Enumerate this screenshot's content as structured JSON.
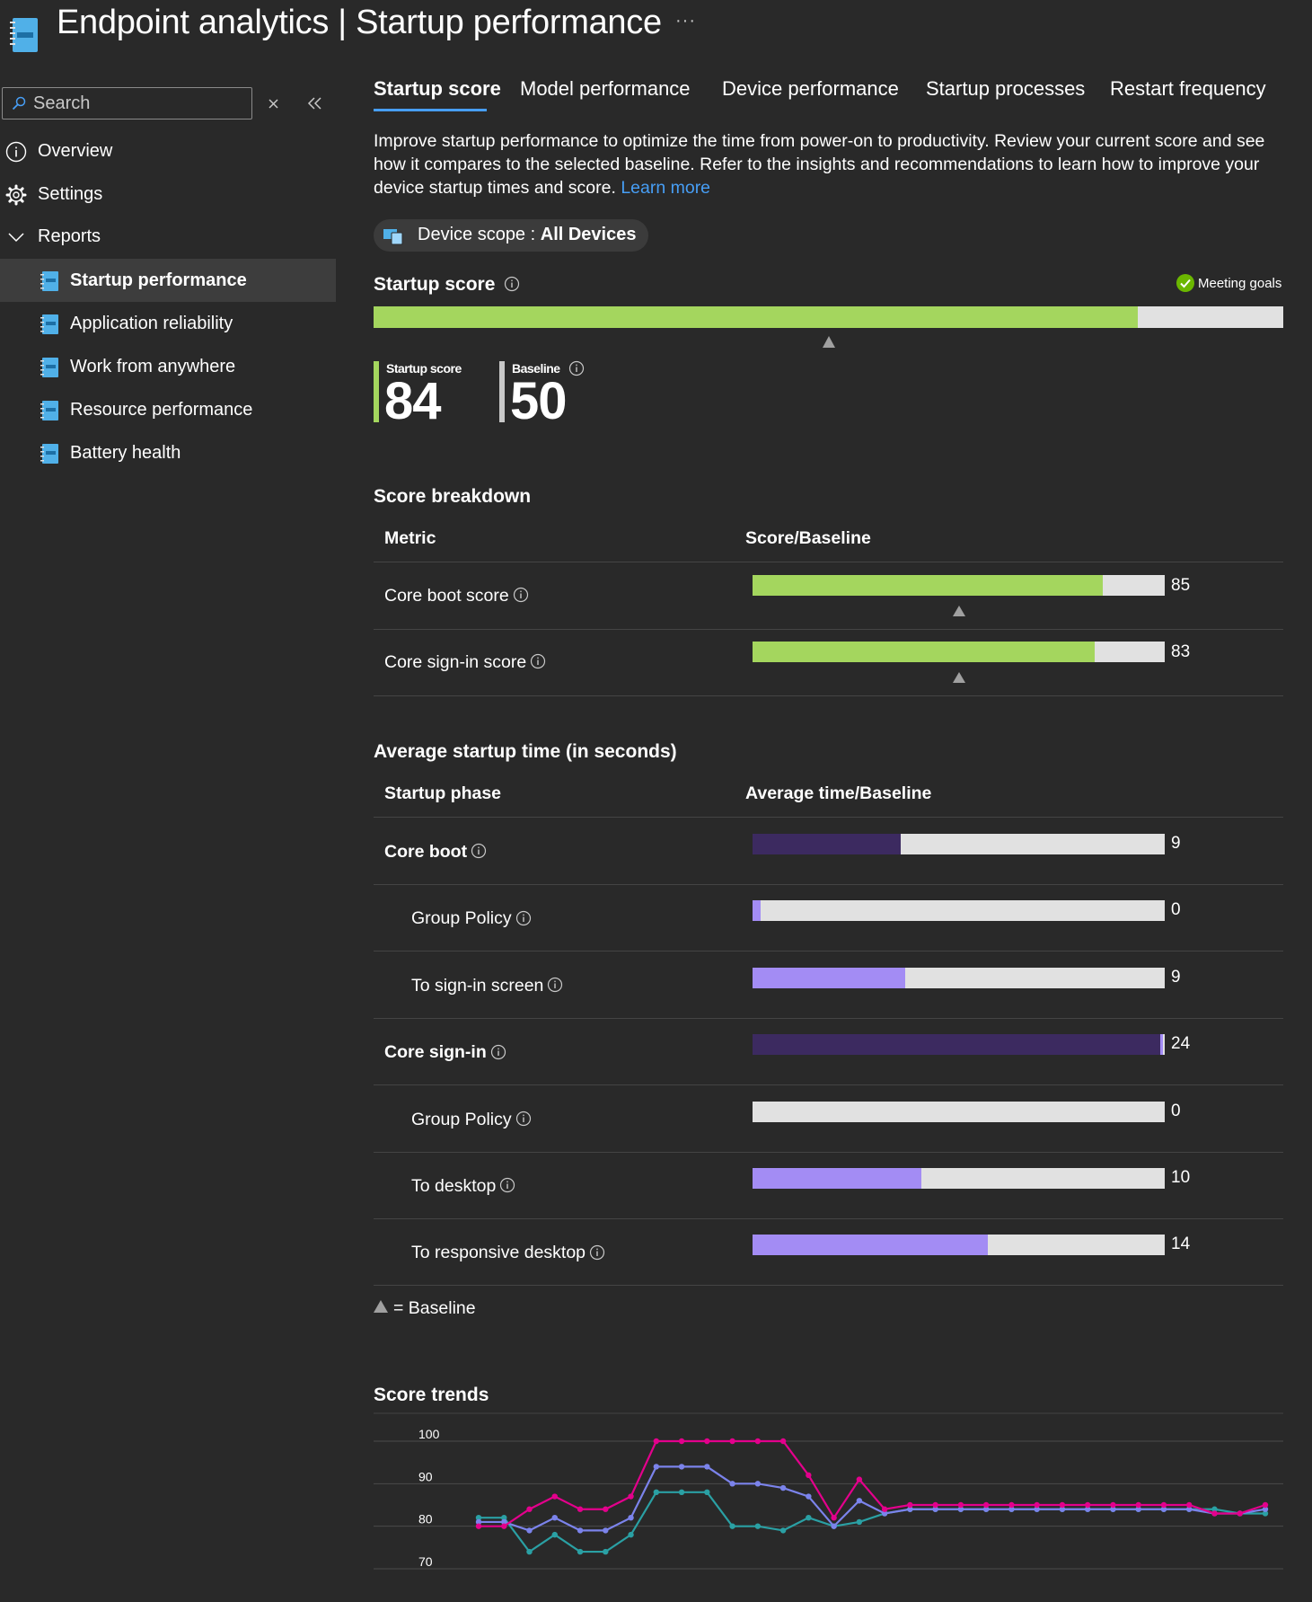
{
  "header": {
    "title": "Endpoint analytics | Startup performance",
    "more": "···"
  },
  "sidebar": {
    "search": {
      "placeholder": "Search",
      "value": ""
    },
    "items": [
      {
        "label": "Overview",
        "icon": "info-icon"
      },
      {
        "label": "Settings",
        "icon": "gear-icon"
      },
      {
        "label": "Reports",
        "icon": "chevron-down-icon"
      }
    ],
    "reports": [
      {
        "label": "Startup performance",
        "active": true
      },
      {
        "label": "Application reliability",
        "active": false
      },
      {
        "label": "Work from anywhere",
        "active": false
      },
      {
        "label": "Resource performance",
        "active": false
      },
      {
        "label": "Battery health",
        "active": false
      }
    ]
  },
  "tabs": [
    {
      "label": "Startup score",
      "active": true
    },
    {
      "label": "Model performance",
      "active": false
    },
    {
      "label": "Device performance",
      "active": false
    },
    {
      "label": "Startup processes",
      "active": false
    },
    {
      "label": "Restart frequency",
      "active": false
    }
  ],
  "description": {
    "text": "Improve startup performance to optimize the time from power-on to productivity. Review your current score and see how it compares to the selected baseline. Refer to the insights and recommendations to learn how to improve your device startup times and score.",
    "learn_more": "Learn more"
  },
  "scope": {
    "label": "Device scope",
    "separator": ":",
    "value": "All Devices"
  },
  "startup_score": {
    "title": "Startup score",
    "status": "Meeting goals",
    "score_label": "Startup score",
    "score": 84,
    "baseline_label": "Baseline",
    "baseline": 50
  },
  "breakdown": {
    "title": "Score breakdown",
    "col_metric": "Metric",
    "col_score": "Score/Baseline",
    "rows": [
      {
        "label": "Core boot score",
        "value": 85
      },
      {
        "label": "Core sign-in score",
        "value": 83
      }
    ]
  },
  "startup_time": {
    "title": "Average startup time (in seconds)",
    "col_phase": "Startup phase",
    "col_time": "Average time/Baseline",
    "rows": [
      {
        "label": "Core boot",
        "value": 9,
        "fill_fraction": 0.36,
        "level": "parent"
      },
      {
        "label": "Group Policy",
        "value": 0,
        "fill_fraction": 0.02,
        "level": "child"
      },
      {
        "label": "To sign-in screen",
        "value": 9,
        "fill_fraction": 0.37,
        "level": "child"
      },
      {
        "label": "Core sign-in",
        "value": 24,
        "fill_fraction": 0.99,
        "level": "parent"
      },
      {
        "label": "Group Policy",
        "value": 0,
        "fill_fraction": 0.0,
        "level": "child"
      },
      {
        "label": "To desktop",
        "value": 10,
        "fill_fraction": 0.41,
        "level": "child"
      },
      {
        "label": "To responsive desktop",
        "value": 14,
        "fill_fraction": 0.57,
        "level": "child"
      }
    ]
  },
  "legend": {
    "baseline_text": "= Baseline"
  },
  "colors": {
    "accent": "#479ef5",
    "score_green": "#a4d65e",
    "bar_bg": "#e1e1e1",
    "parent_purple": "#3c2a60",
    "child_purple": "#a38cf4",
    "baseline_marker": "#a0a0a0",
    "status_green": "#6bb700"
  },
  "trends": {
    "title": "Score trends",
    "chart_data": {
      "type": "line",
      "ylim": [
        70,
        100
      ],
      "y_ticks": [
        100,
        90,
        80,
        70
      ],
      "grid": true,
      "series": [
        {
          "color": "#e3008c",
          "values": [
            80,
            80,
            84,
            87,
            84,
            84,
            87,
            100,
            100,
            100,
            100,
            100,
            100,
            92,
            82,
            91,
            84,
            85,
            85,
            85,
            85,
            85,
            85,
            85,
            85,
            85,
            85,
            85,
            85,
            83,
            83,
            85
          ]
        },
        {
          "color": "#7b83eb",
          "values": [
            81,
            81,
            79,
            82,
            79,
            79,
            82,
            94,
            94,
            94,
            90,
            90,
            89,
            87,
            80,
            86,
            83,
            84,
            84,
            84,
            84,
            84,
            84,
            84,
            84,
            84,
            84,
            84,
            84,
            83,
            83,
            84
          ]
        },
        {
          "color": "#2aa0a4",
          "values": [
            82,
            82,
            74,
            78,
            74,
            74,
            78,
            88,
            88,
            88,
            80,
            80,
            79,
            82,
            80,
            81,
            83,
            84,
            84,
            84,
            84,
            84,
            84,
            84,
            84,
            84,
            84,
            84,
            84,
            84,
            83,
            83
          ]
        }
      ]
    }
  }
}
